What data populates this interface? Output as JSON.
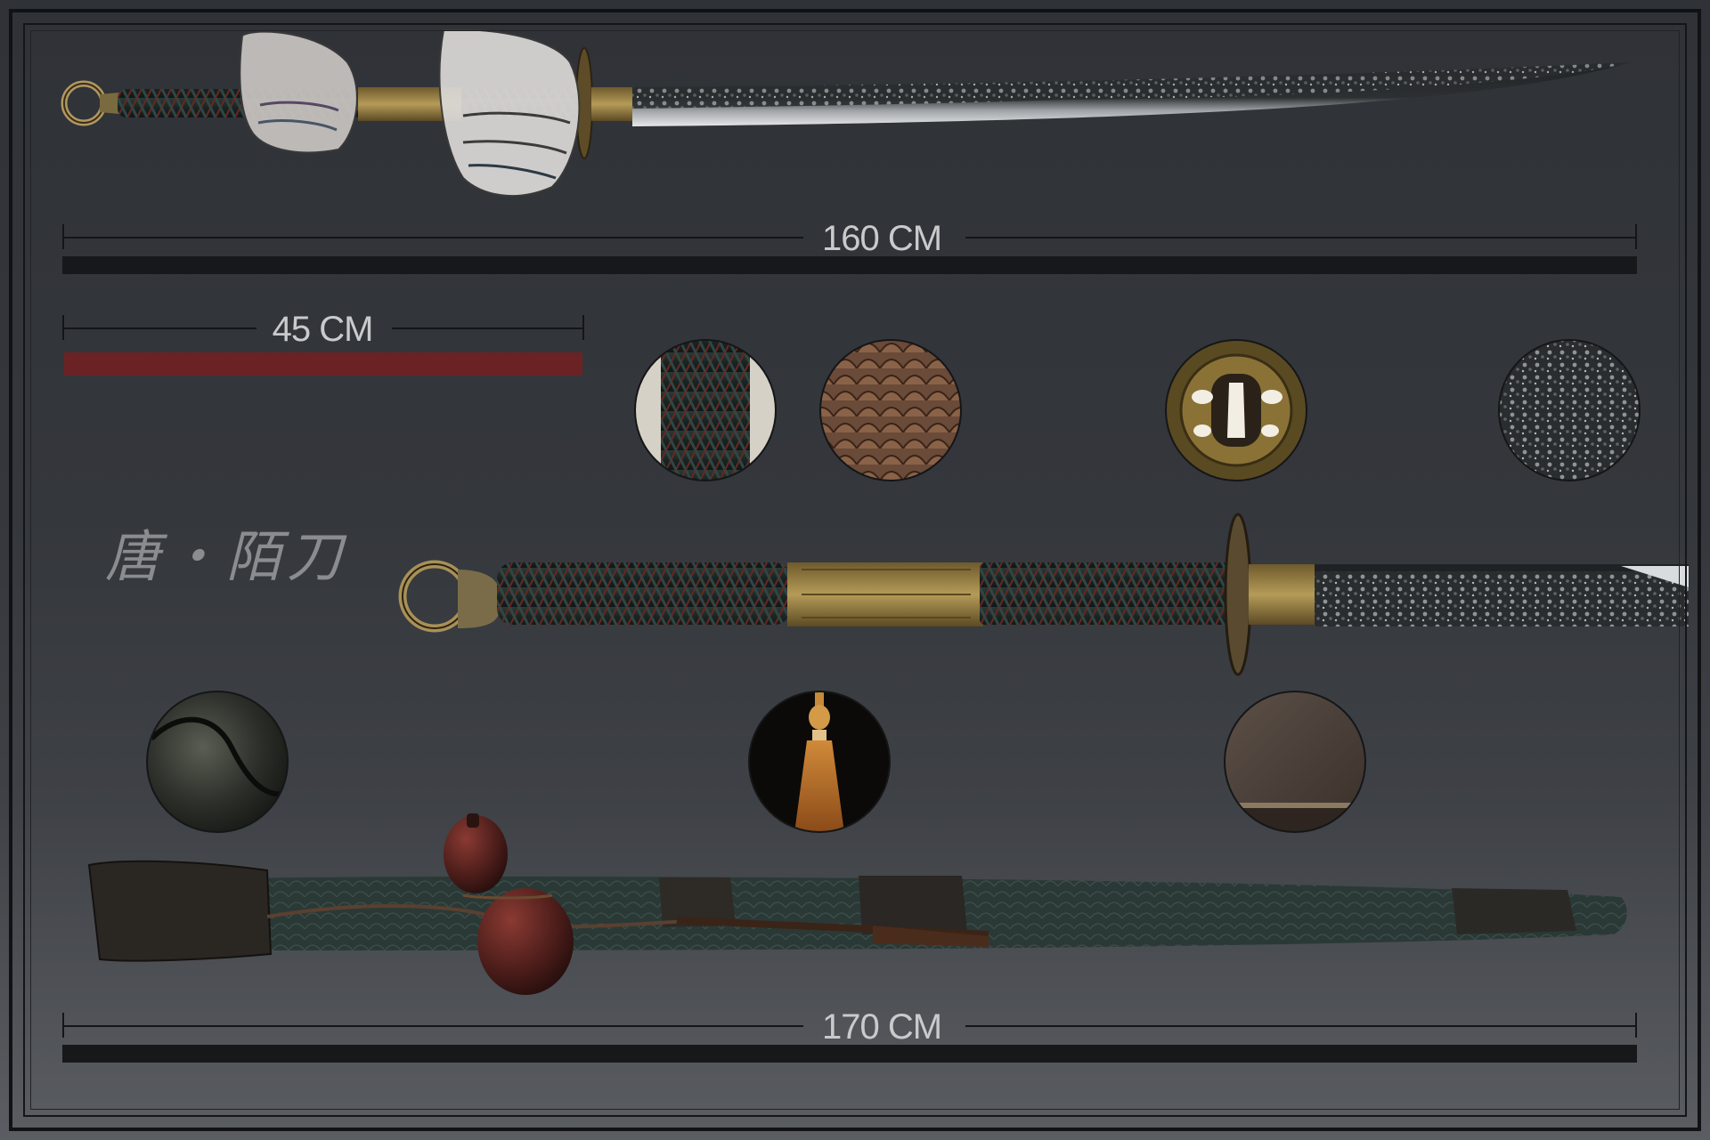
{
  "title_calligraphy": "唐・陌刀",
  "measurements": {
    "sword_length": "160 CM",
    "handle_length": "45 CM",
    "sheathed_length": "170 CM"
  },
  "colors": {
    "background": "#33363b",
    "measure_bar": "#17181a",
    "handle_accent_bar": "#6b2224",
    "blade_steel": "#b9bcc0",
    "blade_texture": "#2a2d30",
    "brass": "#a08848",
    "wrap_dark": "#1f2a28",
    "wrap_red": "#7a2a24",
    "sheath_green": "#2c3b38",
    "gourd": "#4a1f1c"
  },
  "material_swatches": [
    {
      "id": "handle-wrap",
      "icon": "braided-cord-texture-icon"
    },
    {
      "id": "scale-leather",
      "icon": "scale-leather-texture-icon"
    },
    {
      "id": "tsuba-guard",
      "icon": "guard-fitting-texture-icon"
    },
    {
      "id": "forged-steel",
      "icon": "forged-steel-texture-icon"
    },
    {
      "id": "dark-leather",
      "icon": "dark-leather-texture-icon"
    },
    {
      "id": "tassel",
      "icon": "tassel-texture-icon"
    },
    {
      "id": "brown-cloth",
      "icon": "brown-cloth-texture-icon"
    }
  ]
}
